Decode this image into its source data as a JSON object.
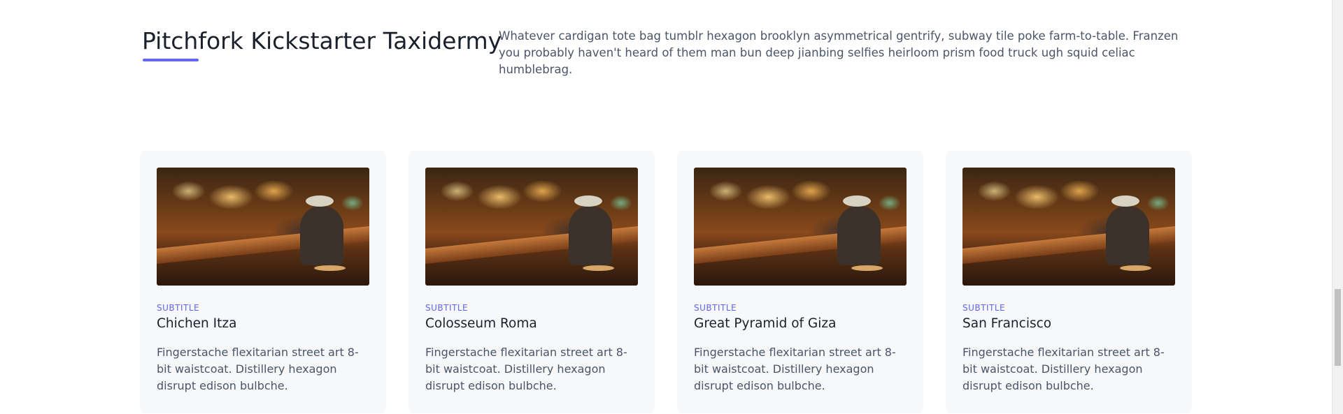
{
  "section": {
    "title": "Pitchfork Kickstarter Taxidermy",
    "description": "Whatever cardigan tote bag tumblr hexagon brooklyn asymmetrical gentrify, subway tile poke farm-to-table. Franzen you probably haven't heard of them man bun deep jianbing selfies heirloom prism food truck ugh squid celiac humblebrag."
  },
  "accent_color": "#6366f1",
  "cards": [
    {
      "subtitle": "SUBTITLE",
      "title": "Chichen Itza",
      "text": "Fingerstache flexitarian street art 8-bit waistcoat. Distillery hexagon disrupt edison bulbche."
    },
    {
      "subtitle": "SUBTITLE",
      "title": "Colosseum Roma",
      "text": "Fingerstache flexitarian street art 8-bit waistcoat. Distillery hexagon disrupt edison bulbche."
    },
    {
      "subtitle": "SUBTITLE",
      "title": "Great Pyramid of Giza",
      "text": "Fingerstache flexitarian street art 8-bit waistcoat. Distillery hexagon disrupt edison bulbche."
    },
    {
      "subtitle": "SUBTITLE",
      "title": "San Francisco",
      "text": "Fingerstache flexitarian street art 8-bit waistcoat. Distillery hexagon disrupt edison bulbche."
    }
  ]
}
